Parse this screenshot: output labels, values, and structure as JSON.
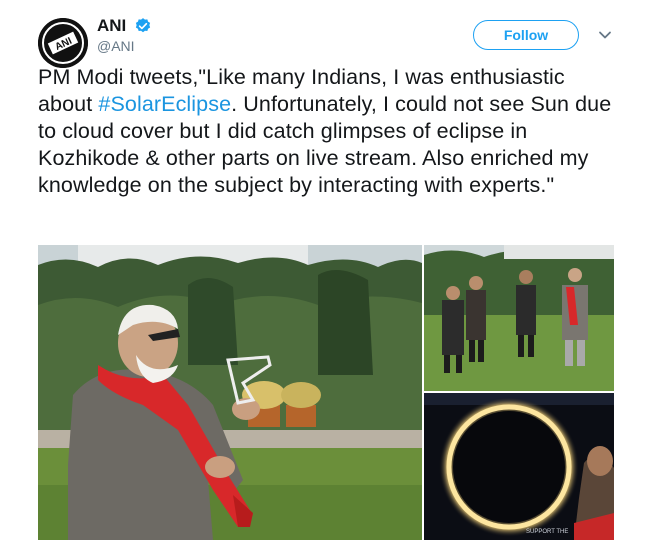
{
  "tweet": {
    "display_name": "ANI",
    "handle": "@ANI",
    "follow_label": "Follow",
    "text_before": "PM Modi tweets,\"Like many Indians, I was enthusiastic about ",
    "hashtag": "#SolarEclipse",
    "text_after": ". Unfortunately, I could not see Sun due to cloud cover but I did catch glimpses of eclipse in Kozhikode & other parts on live stream. Also enriched my knowledge on the subject by interacting with experts.\""
  },
  "icons": {
    "avatar": "ani-logo-icon",
    "verified": "verified-badge-icon",
    "menu": "chevron-down-icon"
  },
  "colors": {
    "accent": "#1da1f2",
    "hashtag": "#1b95e0",
    "text": "#14171a",
    "secondary": "#657786"
  },
  "media": {
    "photos": [
      "man-with-eclipse-glasses-photo",
      "group-in-garden-photo",
      "annular-eclipse-photo"
    ]
  }
}
